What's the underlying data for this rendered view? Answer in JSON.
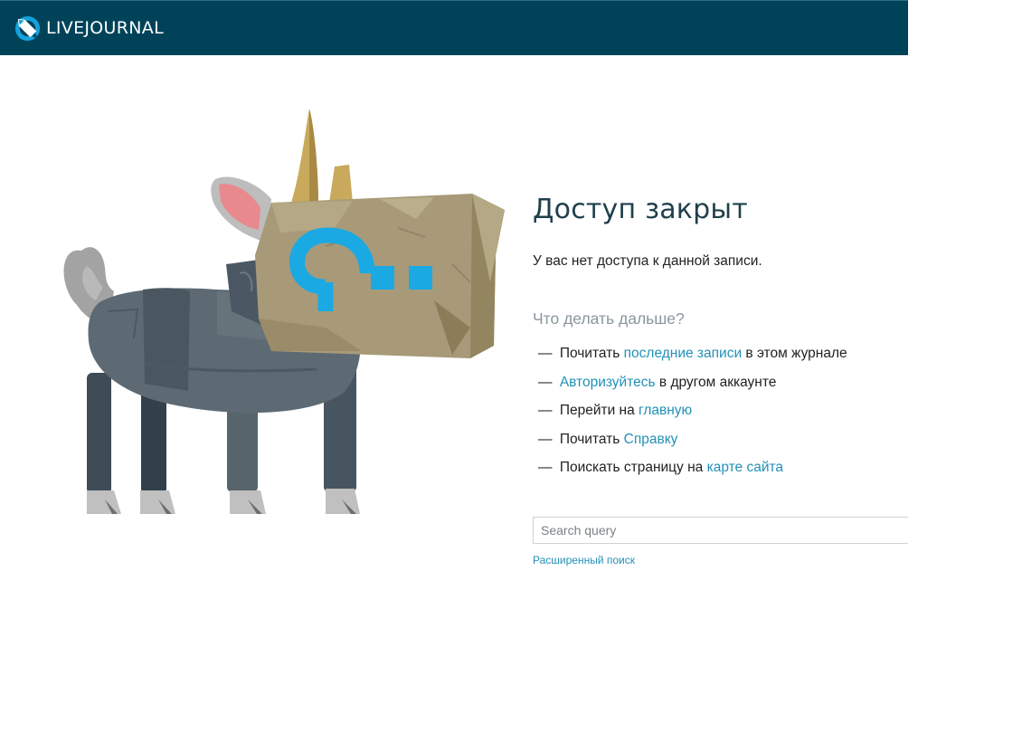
{
  "header": {
    "brand": "LIVEJOURNAL",
    "background_color": "#004359",
    "logo_icon": "livejournal-pencil-logo"
  },
  "main": {
    "title": "Доступ закрыт",
    "subtitle": "У вас нет доступа к данной записи.",
    "next_heading": "Что делать дальше?",
    "options": [
      {
        "prefix": "Почитать ",
        "link": "последние записи",
        "suffix": " в этом журнале"
      },
      {
        "prefix": "",
        "link": "Авторизуйтесь",
        "suffix": " в другом аккаунте"
      },
      {
        "prefix": "Перейти на ",
        "link": "главную",
        "suffix": ""
      },
      {
        "prefix": "Почитать ",
        "link": "Справку",
        "suffix": ""
      },
      {
        "prefix": "Поискать страницу на ",
        "link": "карте сайта",
        "suffix": ""
      }
    ],
    "dash": "—"
  },
  "search": {
    "placeholder": "Search query",
    "advanced_link": "Расширенный поиск"
  },
  "illustration": {
    "subject": "unicorn-with-paper-bag-head",
    "bag_mark": "?..",
    "colors": {
      "bag": "#a89a78",
      "mark": "#1aa9e3",
      "body": "#5a6670",
      "horn": "#c9a95c",
      "ear": "#e8898e"
    }
  },
  "colors": {
    "accent_link": "#2391b7",
    "title": "#1f3f4b",
    "muted": "#8a979c"
  }
}
